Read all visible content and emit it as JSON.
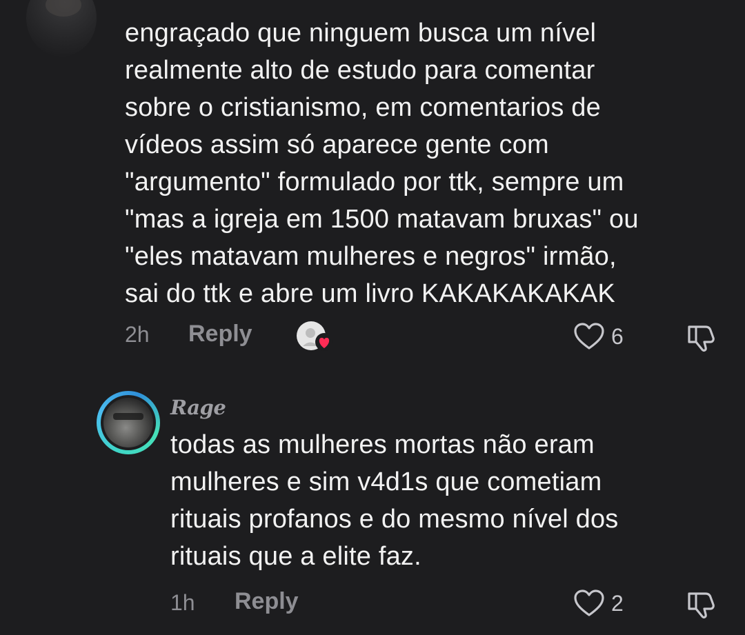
{
  "parent_comment": {
    "text": "engraçado que ninguem busca um nível\nrealmente alto de estudo para comentar\nsobre o cristianismo, em comentarios de\nvídeos assim só aparece gente com\n\"argumento\" formulado por ttk, sempre um\n\"mas a igreja em 1500 matavam bruxas\" ou\n\"eles matavam mulheres e negros\" irmão,\nsai do ttk e abre um livro KAKAKAKAKAK",
    "time": "2h",
    "reply_label": "Reply",
    "like_count": "6",
    "creator_liked_icon": "creator-heart-badge-icon"
  },
  "reply_comment": {
    "username": "Rage",
    "text": "todas as mulheres mortas não eram\nmulheres e sim v4d1s que cometiam\nrituais profanos e do mesmo nível dos\nrituais que a elite faz.",
    "time": "1h",
    "reply_label": "Reply",
    "like_count": "2"
  },
  "colors": {
    "background": "#1d1d1f",
    "text": "#f2f2f2",
    "muted": "#8e8e93",
    "ring_start": "#3fd6c6",
    "ring_end": "#2f8fd9",
    "heart_badge": "#fe2c55"
  }
}
